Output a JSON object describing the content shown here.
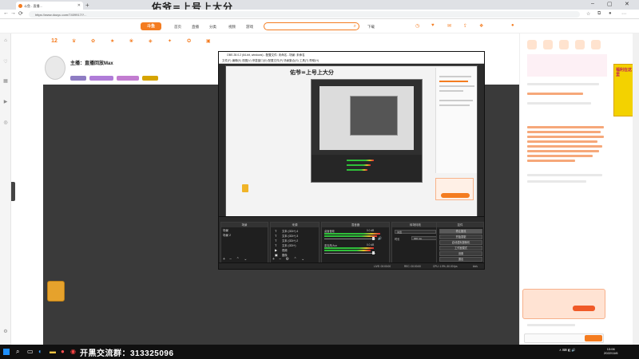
{
  "browser": {
    "tab_title": "斗鱼 - 直播...",
    "url": "https://www.douyu.com/7409917/?...",
    "title_overlay": "佑爷=上号上大分"
  },
  "site": {
    "logo": "斗鱼",
    "nav": [
      "首页",
      "直播",
      "分类",
      "视频",
      "游戏",
      "下载"
    ],
    "search_placeholder": ""
  },
  "room": {
    "title": "主播：直播回放Max",
    "subtitle": "",
    "tags": [
      "",
      "",
      "",
      ""
    ],
    "stat_num": "12",
    "stat_label": ""
  },
  "obs": {
    "title": "OBS 28.0.2 (64-bit, windows) - 配置文件: 未命名 - 场景: 未命名",
    "menu": "文件(F)  编辑(E)  视图(V)  停靠窗口(D)  配置文件(P)  场景集合(S)  工具(T)  帮助(H)",
    "nested_title": "佑爷=上号上大分",
    "docks": {
      "scenes": "场景",
      "sources": "来源",
      "mixer": "混音器",
      "transitions": "转场特效",
      "controls": "控件"
    },
    "scenes": [
      "场景",
      "场景 2"
    ],
    "sources": [
      "文本 (GDI+) 4",
      "文本 (GDI+) 3",
      "文本 (GDI+) 2",
      "文本 (GDI+)",
      "视频",
      "图像"
    ],
    "mixer": [
      "桌面音频",
      "麦克风/Aux"
    ],
    "mixer_db": [
      "0.0 dB",
      "0.0 dB"
    ],
    "transition": {
      "type_label": "淡出",
      "duration_label": "时长",
      "duration_value": "300 ms"
    },
    "controls": [
      "停止推流",
      "开始录制",
      "启动虚拟摄像机",
      "工作室模式",
      "设置",
      "退出"
    ],
    "status": [
      "LIVE: 00:00:00",
      "REC: 00:00:00",
      "CPU: 1.9%, 60.00 fps",
      "kb/s"
    ]
  },
  "taskbar": {
    "overlay": "开黑交流群：313325096",
    "time": "13:06",
    "date": "2022/11/6"
  },
  "chat_banner": "福利在这里"
}
